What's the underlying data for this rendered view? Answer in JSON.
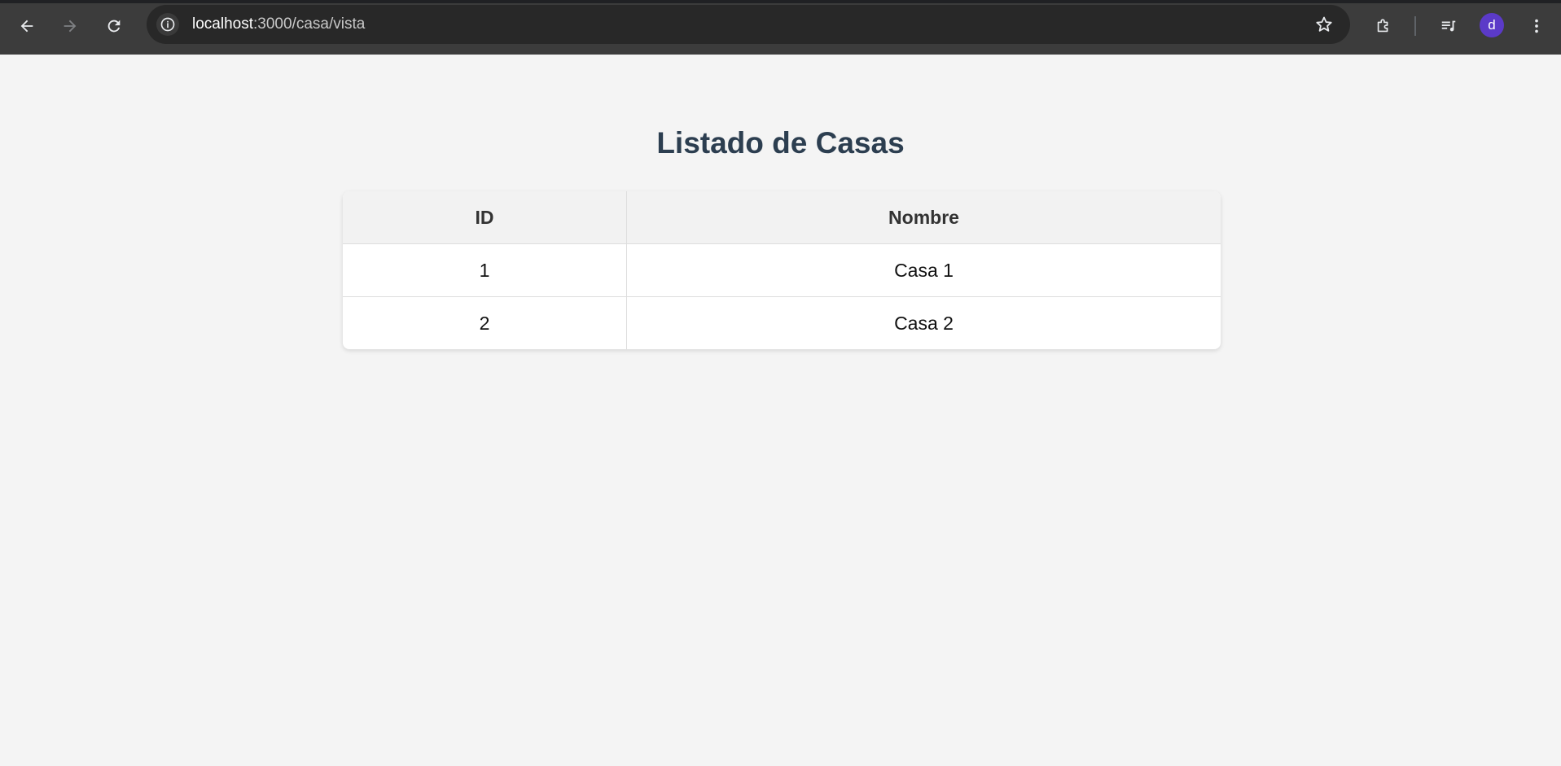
{
  "browser": {
    "url_host": "localhost",
    "url_path": ":3000/casa/vista",
    "profile_initial": "d",
    "avatar_color": "#5b3ac8",
    "icons": [
      "back-arrow-icon",
      "forward-arrow-icon",
      "reload-icon",
      "info-icon",
      "star-icon",
      "extensions-icon",
      "media-controls-icon",
      "more-vert-icon"
    ]
  },
  "page": {
    "title": "Listado de Casas",
    "title_color": "#2c3e50"
  },
  "table": {
    "headers": {
      "id": "ID",
      "nombre": "Nombre"
    },
    "rows": [
      {
        "id": "1",
        "nombre": "Casa 1"
      },
      {
        "id": "2",
        "nombre": "Casa 2"
      }
    ]
  }
}
